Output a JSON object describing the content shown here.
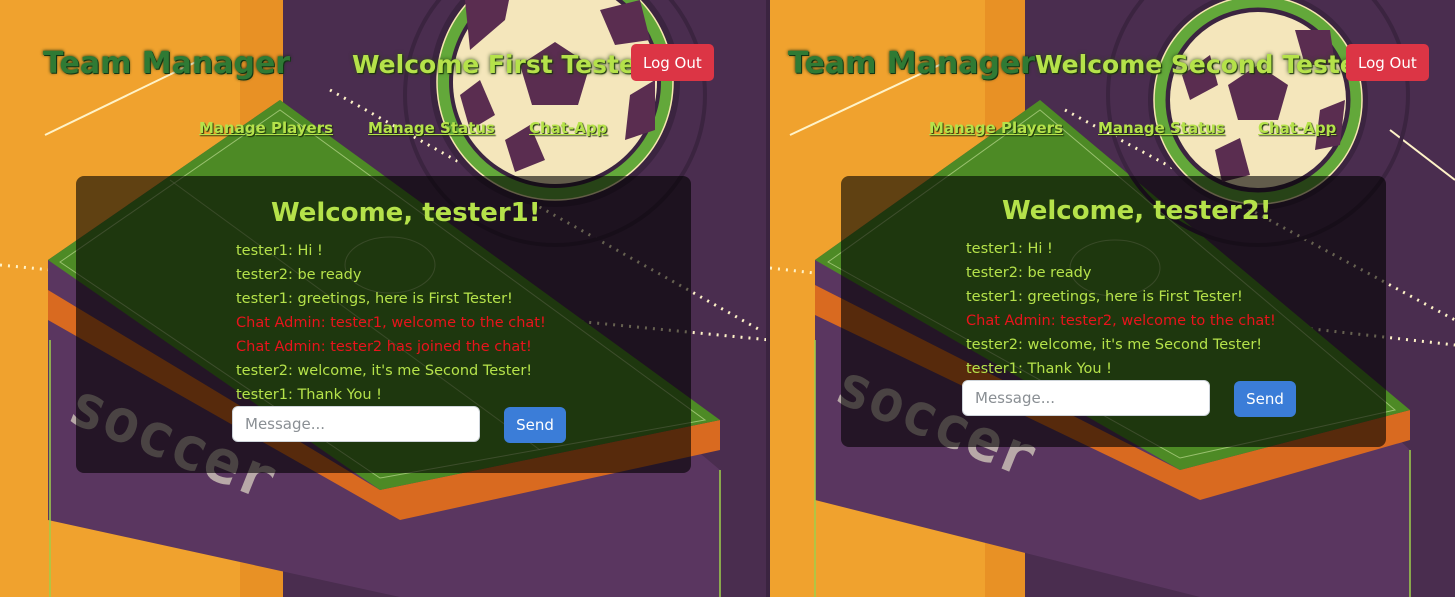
{
  "panels": [
    {
      "brand": "Team Manager",
      "welcome": "Welcome First Tester",
      "logout_label": "Log Out",
      "nav": [
        "Manage Players",
        "Manage Status",
        "Chat-App"
      ],
      "chat": {
        "heading": "Welcome, tester1!",
        "messages": [
          {
            "text": "tester1: Hi !",
            "type": "user"
          },
          {
            "text": "tester2: be ready",
            "type": "user"
          },
          {
            "text": "tester1: greetings, here is First Tester!",
            "type": "user"
          },
          {
            "text": "Chat Admin: tester1, welcome to the chat!",
            "type": "admin"
          },
          {
            "text": "Chat Admin: tester2 has joined the chat!",
            "type": "admin"
          },
          {
            "text": "tester2: welcome, it's me Second Tester!",
            "type": "user"
          },
          {
            "text": "tester1: Thank You !",
            "type": "user"
          }
        ],
        "input_placeholder": "Message...",
        "send_label": "Send"
      }
    },
    {
      "brand": "Team Manager",
      "welcome": "Welcome Second Tester",
      "logout_label": "Log Out",
      "nav": [
        "Manage Players",
        "Manage Status",
        "Chat-App"
      ],
      "chat": {
        "heading": "Welcome, tester2!",
        "messages": [
          {
            "text": "tester1: Hi !",
            "type": "user"
          },
          {
            "text": "tester2: be ready",
            "type": "user"
          },
          {
            "text": "tester1: greetings, here is First Tester!",
            "type": "user"
          },
          {
            "text": "Chat Admin: tester2, welcome to the chat!",
            "type": "admin"
          },
          {
            "text": "tester2: welcome, it's me Second Tester!",
            "type": "user"
          },
          {
            "text": "tester1: Thank You !",
            "type": "user"
          }
        ],
        "input_placeholder": "Message...",
        "send_label": "Send"
      }
    }
  ],
  "background": {
    "decal_text": "soccer",
    "colors": {
      "orange": "#f0a22e",
      "purple": "#4a2d4f",
      "field_green": "#4d8a25",
      "accent_green": "#b5e24a",
      "admin_red": "#e8141c",
      "logout_red": "#dc3545",
      "send_blue": "#3b7dd8"
    }
  }
}
